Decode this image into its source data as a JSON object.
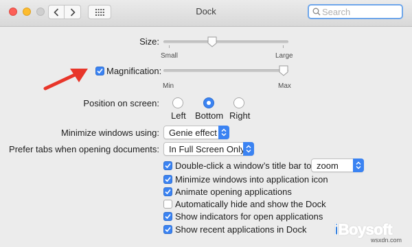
{
  "window": {
    "title": "Dock",
    "search": {
      "placeholder": "Search",
      "value": ""
    }
  },
  "size": {
    "label": "Size:",
    "min_label": "Small",
    "max_label": "Large",
    "level": 0.38
  },
  "magnification": {
    "label": "Magnification:",
    "checked": true,
    "min_label": "Min",
    "max_label": "Max",
    "level": 1.0
  },
  "position": {
    "label": "Position on screen:",
    "options": [
      {
        "label": "Left",
        "selected": false
      },
      {
        "label": "Bottom",
        "selected": true
      },
      {
        "label": "Right",
        "selected": false
      }
    ]
  },
  "minimize": {
    "label": "Minimize windows using:",
    "value": "Genie effect"
  },
  "prefer_tabs": {
    "label": "Prefer tabs when opening documents:",
    "value": "In Full Screen Only"
  },
  "options": [
    {
      "label": "Double-click a window’s title bar to",
      "checked": true
    },
    {
      "label": "Minimize windows into application icon",
      "checked": true
    },
    {
      "label": "Animate opening applications",
      "checked": true
    },
    {
      "label": "Automatically hide and show the Dock",
      "checked": false
    },
    {
      "label": "Show indicators for open applications",
      "checked": true
    },
    {
      "label": "Show recent applications in Dock",
      "checked": true
    }
  ],
  "double_click_action": {
    "value": "zoom"
  },
  "watermark": {
    "brand": "iBoysoft",
    "site": "wsxdn.com"
  },
  "icons": {
    "back": "chevron-left-icon",
    "forward": "chevron-right-icon",
    "grid": "grid-icon",
    "search": "search-icon",
    "annotation": "red-arrow-icon"
  },
  "colors": {
    "accent": "#3b83f2",
    "annotation_arrow": "#e8362a",
    "window_bg": "#ececec"
  }
}
